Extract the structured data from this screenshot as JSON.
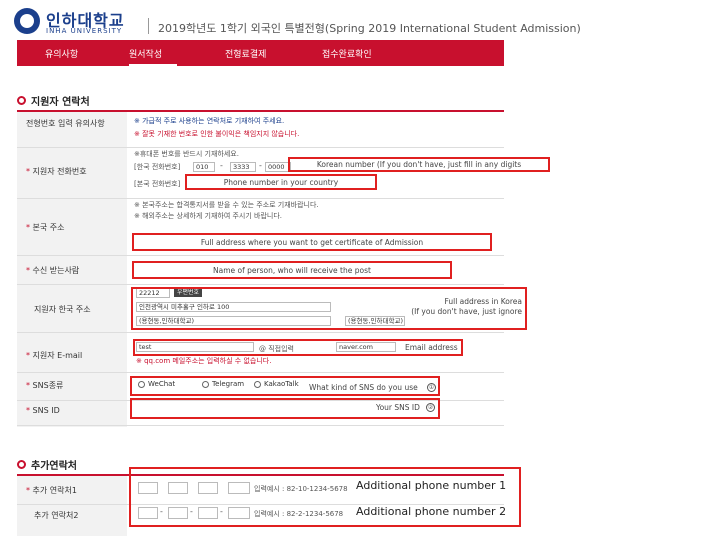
{
  "header": {
    "logo_kr": "인하대학교",
    "logo_en": "INHA UNIVERSITY",
    "title": "2019학년도 1학기 외국인 특별전형(Spring 2019 International Student Admission)"
  },
  "nav": {
    "items": [
      "유의사항",
      "원서작성",
      "전형료결제",
      "접수완료확인"
    ],
    "active_index": 1
  },
  "section1": {
    "title": "지원자 연락처",
    "rows": {
      "register": {
        "label": "전형번호 입력 유의사항",
        "note1": "※ 가급적 주로 사용하는 연락처로 기재하여 주세요.",
        "note2": "※ 잘못 기재한 번호로 인한 불이익은 책임지지 않습니다."
      },
      "phone": {
        "label": "지원자 전화번호",
        "note": "※휴대폰 번호를 반드시 기재하세요.",
        "korea_label": "[한국 전화번호]",
        "country_label": "[본국 전화번호]",
        "prefix_value": "010",
        "mid_value": "3333",
        "last_value": "0000",
        "annot_korea": "Korean number (If you don't have, just fill in any digits",
        "annot_country": "Phone number in your country"
      },
      "home_address": {
        "label": "본국 주소",
        "note1": "※ 본국주소는 합격통지서를 받을 수 있는 주소로 기재바랍니다.",
        "note2": "※ 해외주소는 상세하게 기재하여 주시기 바랍니다.",
        "annot": "Full address where you want to get certificate of Admission"
      },
      "receiver": {
        "label": "수신 받는사람",
        "annot": "Name of person, who will receive the post"
      },
      "korea_address": {
        "label": "지원자 한국 주소",
        "zip_value": "22212",
        "zip_button": "우편번호",
        "addr_value": "인천광역시 미추홀구 인하로 100",
        "detail_value": "(용현동,인하대학교)",
        "extra_value": "(용현동,인하대학교)",
        "annot1": "Full address in Korea",
        "annot2": "(If you don't have, just ignore"
      },
      "email": {
        "label": "지원자 E-mail",
        "id_value": "test",
        "direct_input": "직접입력",
        "domain_value": "naver.com",
        "note": "※ qq.com 메일주소는 입력하실 수 없습니다.",
        "annot": "Email address"
      },
      "sns_type": {
        "label": "SNS종류",
        "options": [
          "WeChat",
          "Telegram",
          "KakaoTalk"
        ],
        "annot": "What kind of SNS do you use",
        "circ": "①"
      },
      "sns_id": {
        "label": "SNS ID",
        "annot": "Your SNS ID",
        "circ": "②"
      }
    }
  },
  "section2": {
    "title": "추가연락처",
    "rows": {
      "extra1": {
        "label": "추가 연락처1",
        "example": "입력예시 : 82-10-1234-5678",
        "annot": "Additional phone number 1"
      },
      "extra2": {
        "label": "추가 연락처2",
        "example": "입력예시 : 82-2-1234-5678",
        "annot": "Additional phone number 2"
      }
    }
  },
  "colors": {
    "brand_red": "#c8102e",
    "annot_red": "#e02020",
    "brand_blue": "#1b3f8c"
  }
}
